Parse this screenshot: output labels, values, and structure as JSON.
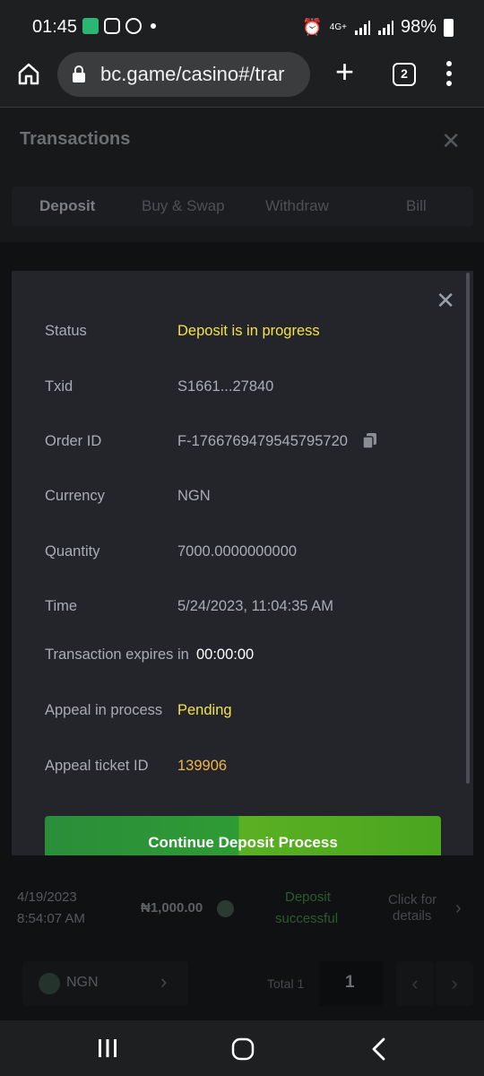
{
  "status_bar": {
    "time": "01:45",
    "network": "4G+",
    "battery": "98%"
  },
  "browser": {
    "url": "bc.game/casino#/trar",
    "tab_count": "2"
  },
  "page": {
    "title": "Transactions",
    "tabs": [
      {
        "label": "Deposit",
        "active": true
      },
      {
        "label": "Buy & Swap",
        "active": false
      },
      {
        "label": "Withdraw",
        "active": false
      },
      {
        "label": "Bill",
        "active": false
      }
    ],
    "bg_row": {
      "date": "4/19/2023",
      "time": "8:54:07 AM",
      "amount": "₦1,000.00",
      "status_line1": "Deposit",
      "status_line2": "successful",
      "details_line1": "Click for",
      "details_line2": "details"
    },
    "footer": {
      "currency": "NGN",
      "total": "Total 1",
      "page": "1"
    }
  },
  "modal": {
    "fields": [
      {
        "label": "Status",
        "value": "Deposit is in progress"
      },
      {
        "label": "Txid",
        "value": "S1661...27840"
      },
      {
        "label": "Order ID",
        "value": "F-1766769479545795720"
      },
      {
        "label": "Currency",
        "value": "NGN"
      },
      {
        "label": "Quantity",
        "value": "7000.0000000000"
      },
      {
        "label": "Time",
        "value": "5/24/2023, 11:04:35 AM"
      }
    ],
    "expires_label": "Transaction expires in",
    "expires_value": "00:00:00",
    "appeal_label": "Appeal in process",
    "appeal_value": "Pending",
    "ticket_label": "Appeal ticket ID",
    "ticket_value": "139906",
    "cta": "Continue Deposit Process"
  },
  "colors": {
    "accent_yellow": "#f3e24a",
    "accent_orange": "#f0b44a",
    "green": "#4aa51f"
  }
}
